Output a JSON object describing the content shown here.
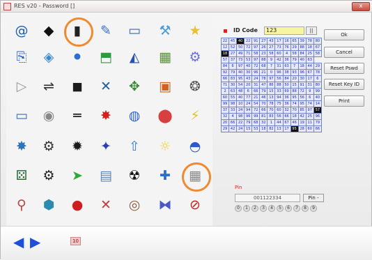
{
  "window": {
    "title": "RES v20 - Password []",
    "close_glyph": "x"
  },
  "icons": [
    [
      "at-sign-icon",
      "diamond-icon",
      "barcode-icon",
      "pen-icon",
      "card-icon",
      "tools-icon",
      "star-icon"
    ],
    [
      "document-arrow-icon",
      "cube-icon",
      "network-icon",
      "gift-icon",
      "sail-icon",
      "picture-icon",
      "cogs-icon"
    ],
    [
      "play-icon",
      "toggle-icon",
      "square-icon",
      "x-cross-icon",
      "puzzle-icon",
      "abc-block-icon",
      "knot-icon"
    ],
    [
      "window-icon",
      "switch-icon",
      "equals-icon",
      "sparkle-icon",
      "disc-icon",
      "color-balls-icon",
      "lightning-icon"
    ],
    [
      "web-icon",
      "gears-icon",
      "virus-icon",
      "figure-icon",
      "upload-icon",
      "bulb-icon",
      "helmet-icon"
    ],
    [
      "dice-icon",
      "engine-icon",
      "arrow-icon",
      "clipboard-icon",
      "radiation-icon",
      "plug-icon",
      "grid-square-icon"
    ],
    [
      "magnet-icon",
      "cube-blue-icon",
      "red-balls-icon",
      "times-icon",
      "spiral-icon",
      "dna-icon",
      "no-entry-icon"
    ]
  ],
  "icon_glyphs": [
    [
      "@",
      "◆",
      "▮",
      "✎",
      "▭",
      "⚒",
      "★"
    ],
    [
      "⎘",
      "◈",
      "⚫",
      "⬒",
      "◭",
      "▦",
      "⚙"
    ],
    [
      "▷",
      "⇌",
      "◼",
      "✕",
      "✥",
      "▣",
      "❂"
    ],
    [
      "▭",
      "◉",
      "═",
      "✸",
      "◍",
      "⬤",
      "⚡"
    ],
    [
      "✸",
      "⚙",
      "✹",
      "✦",
      "⇧",
      "☼",
      "◓"
    ],
    [
      "⚄",
      "⚙",
      "➤",
      "▤",
      "☢",
      "✚",
      "▦"
    ],
    [
      "⚲",
      "⬢",
      "●",
      "✕",
      "◎",
      "⧓",
      "⊘"
    ]
  ],
  "icon_colors": [
    [
      "#1a5ea8",
      "#111111",
      "#222222",
      "#3a6fc8",
      "#3a6aa8",
      "#4d9bd8",
      "#e9c12f"
    ],
    [
      "#2c62c7",
      "#3a8ad8",
      "#2d6fd0",
      "#2d9a42",
      "#2550b8",
      "#5a8e3a",
      "#6d6fd8"
    ],
    [
      "#999999",
      "#2e2e2e",
      "#1b1b1b",
      "#1f5c9c",
      "#3c8a3c",
      "#d2611d",
      "#555555"
    ],
    [
      "#3b6ec0",
      "#888888",
      "#111111",
      "#d81f1f",
      "#2b5fd0",
      "#d84040",
      "#d8c324"
    ],
    [
      "#2f73b8",
      "#333333",
      "#1a1a1a",
      "#2b3db8",
      "#2a7fd3",
      "#f2d23c",
      "#2c58c8"
    ],
    [
      "#2c6a3e",
      "#222222",
      "#2da93a",
      "#5b86b8",
      "#111111",
      "#2b6fc8",
      "#8a8a8a"
    ],
    [
      "#c0423a",
      "#2a8ab0",
      "#cc2020",
      "#c43a3a",
      "#8a5c3c",
      "#4b58c8",
      "#c81e1e"
    ]
  ],
  "circled_icons": [
    "barcode-icon",
    "grid-square-icon"
  ],
  "id_code": {
    "label": "ID Code",
    "value": "123",
    "button": "||"
  },
  "number_grid": [
    [
      "22",
      "45",
      "40",
      "22",
      "91",
      "27",
      "43",
      "17",
      "16",
      "65",
      "39",
      "78",
      "80"
    ],
    [
      "12",
      "52",
      "50",
      "72",
      "97",
      "26",
      "27",
      "73",
      "76",
      "29",
      "88",
      "18",
      "67"
    ],
    [
      "18",
      "27",
      "49",
      "71",
      "58",
      "23",
      "58",
      "60",
      "4",
      "58",
      "84",
      "25",
      "58"
    ],
    [
      "57",
      "37",
      "73",
      "53",
      "97",
      "88",
      "9",
      "42",
      "36",
      "79",
      "40",
      "63"
    ],
    [
      "84",
      "6",
      "97",
      "40",
      "72",
      "68",
      "7",
      "31",
      "63",
      "7",
      "18",
      "44",
      "29"
    ],
    [
      "92",
      "79",
      "40",
      "30",
      "96",
      "21",
      "0",
      "96",
      "38",
      "93",
      "96",
      "67",
      "78"
    ],
    [
      "66",
      "83",
      "95",
      "43",
      "24",
      "78",
      "97",
      "56",
      "84",
      "20",
      "30",
      "17",
      "6"
    ],
    [
      "71",
      "30",
      "54",
      "20",
      "31",
      "47",
      "86",
      "88",
      "50",
      "15",
      "91",
      "31",
      "80"
    ],
    [
      "2",
      "63",
      "48",
      "6",
      "66",
      "79",
      "15",
      "33",
      "69",
      "88",
      "72",
      "9",
      "99"
    ],
    [
      "60",
      "55",
      "40",
      "77",
      "21",
      "46",
      "13",
      "94",
      "36",
      "95",
      "56",
      "6",
      "40"
    ],
    [
      "99",
      "98",
      "10",
      "24",
      "54",
      "70",
      "78",
      "75",
      "36",
      "74",
      "95",
      "74",
      "14"
    ],
    [
      "37",
      "33",
      "24",
      "94",
      "72",
      "66",
      "70",
      "60",
      "32",
      "70",
      "85",
      "97",
      "57"
    ],
    [
      "32",
      "4",
      "98",
      "96",
      "99",
      "81",
      "83",
      "56",
      "66",
      "18",
      "42",
      "25",
      "96"
    ],
    [
      "20",
      "66",
      "22",
      "79",
      "68",
      "32",
      "1",
      "44",
      "67",
      "46",
      "19",
      "11",
      "79"
    ],
    [
      "29",
      "42",
      "24",
      "15",
      "53",
      "18",
      "82",
      "13",
      "17",
      "95",
      "28",
      "60",
      "66"
    ]
  ],
  "dark_cells": [
    "0-2",
    "2-0",
    "11-12",
    "14-9"
  ],
  "buttons": {
    "ok": "Ok",
    "cancel": "Cancel",
    "reset_pswd": "Reset Pswd",
    "reset_key": "Reset Key ID",
    "print": "Print"
  },
  "pin": {
    "label": "Pin",
    "value": "001122334",
    "button": "Pin -",
    "digits": [
      "0",
      "1",
      "2",
      "3",
      "4",
      "5",
      "6",
      "7",
      "8",
      "9"
    ]
  },
  "nav": {
    "back_glyph": "◀",
    "forward_glyph": "▶",
    "page": "10"
  }
}
